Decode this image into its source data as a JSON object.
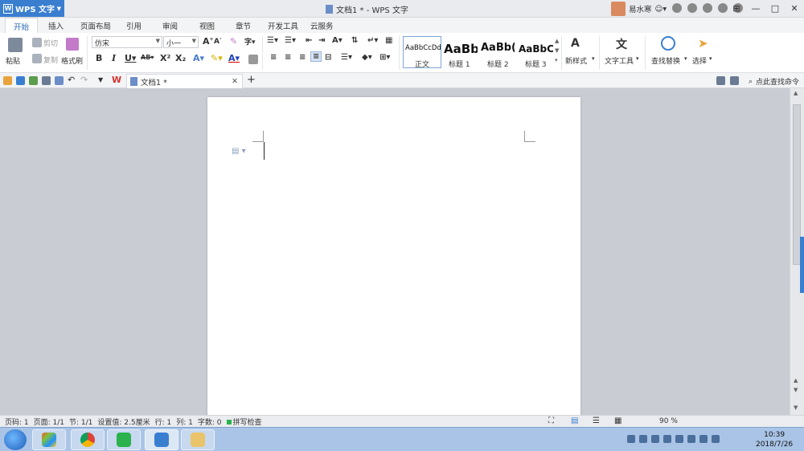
{
  "app": {
    "button_label": "WPS 文字",
    "window_title": "文档1 * - WPS 文字",
    "user_name": "易水寒"
  },
  "menu_tabs": [
    "开始",
    "插入",
    "页面布局",
    "引用",
    "审阅",
    "视图",
    "章节",
    "开发工具",
    "云服务"
  ],
  "ribbon": {
    "paste": "粘贴",
    "cut": "剪切",
    "copy": "复制",
    "format_painter": "格式刷",
    "font_name": "仿宋",
    "font_size": "小一",
    "styles": [
      {
        "preview": "AaBbCcDd",
        "label": "正文"
      },
      {
        "preview": "AaBb",
        "label": "标题 1"
      },
      {
        "preview": "AaBb(",
        "label": "标题 2"
      },
      {
        "preview": "AaBbC",
        "label": "标题 3"
      }
    ],
    "new_style": "新样式",
    "text_tools": "文字工具",
    "find_replace": "查找替换",
    "select": "选择"
  },
  "doc_tab": {
    "title": "文档1 *"
  },
  "find_command": "点此查找命令",
  "status": {
    "page": "页码: 1",
    "pages": "页面: 1/1",
    "section": "节: 1/1",
    "settings": "设置值: 2.5厘米",
    "row": "行: 1",
    "col": "列: 1",
    "words": "字数: 0",
    "spell": "拼写检查",
    "zoom": "90 %"
  },
  "clock": {
    "time": "10:39",
    "date": "2018/7/26"
  },
  "colors": {
    "accent": "#3a7ed0",
    "tab_active_text": "#2466b8"
  }
}
